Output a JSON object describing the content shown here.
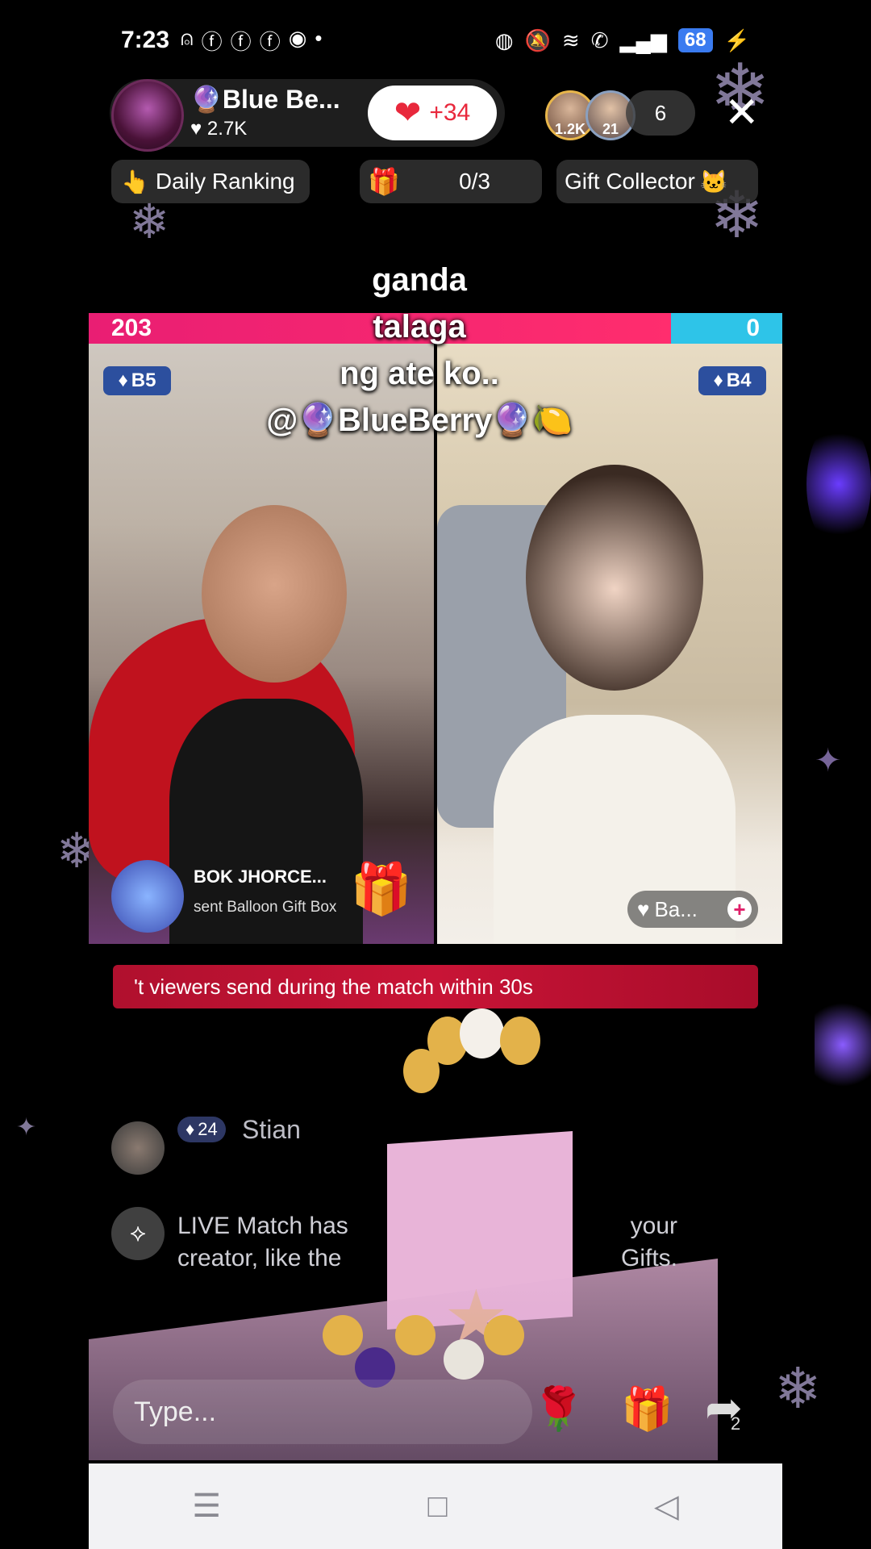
{
  "status_bar": {
    "time": "7:23",
    "battery": "68",
    "left_icons": [
      "person-icon",
      "facebook-icon",
      "facebook-icon",
      "facebook-icon",
      "messenger-icon"
    ],
    "right_icons": [
      "vpn-icon",
      "mute-icon",
      "wifi-icon",
      "call-icon",
      "signal-icon",
      "charging-icon"
    ]
  },
  "host": {
    "name": "🔮Blue Be...",
    "likes": "2.7K",
    "like_count": "+34"
  },
  "viewers": {
    "avatar_1_label": "1.2K",
    "avatar_2_label": "21",
    "count": "6"
  },
  "chips": {
    "daily_ranking": "Daily Ranking",
    "progress": "0/3",
    "gift_collector": "Gift Collector"
  },
  "caption": {
    "line1": "ganda",
    "line2": "talaga",
    "line3": "ng ate ko..",
    "line4": "@🔮BlueBerry🔮🍋"
  },
  "battle": {
    "score_left": "203",
    "score_right": "0",
    "badge_left": "B5",
    "badge_right": "B4",
    "right_name": "Ba...",
    "colors": {
      "left": "#e91e73",
      "right": "#2ec4e8"
    }
  },
  "gift_notice": {
    "sender": "BOK JHORCE...",
    "text": "sent Balloon Gift Box"
  },
  "banner_text": "'t viewers send during the match within 30s",
  "comments": {
    "user_level": "24",
    "user_name": "Stian",
    "live_msg_1": "LIVE Match has",
    "live_msg_1_end": "your",
    "live_msg_2": "creator, like the",
    "live_msg_2_end": "Gifts."
  },
  "input": {
    "placeholder": "Type..."
  },
  "share_count": "2"
}
